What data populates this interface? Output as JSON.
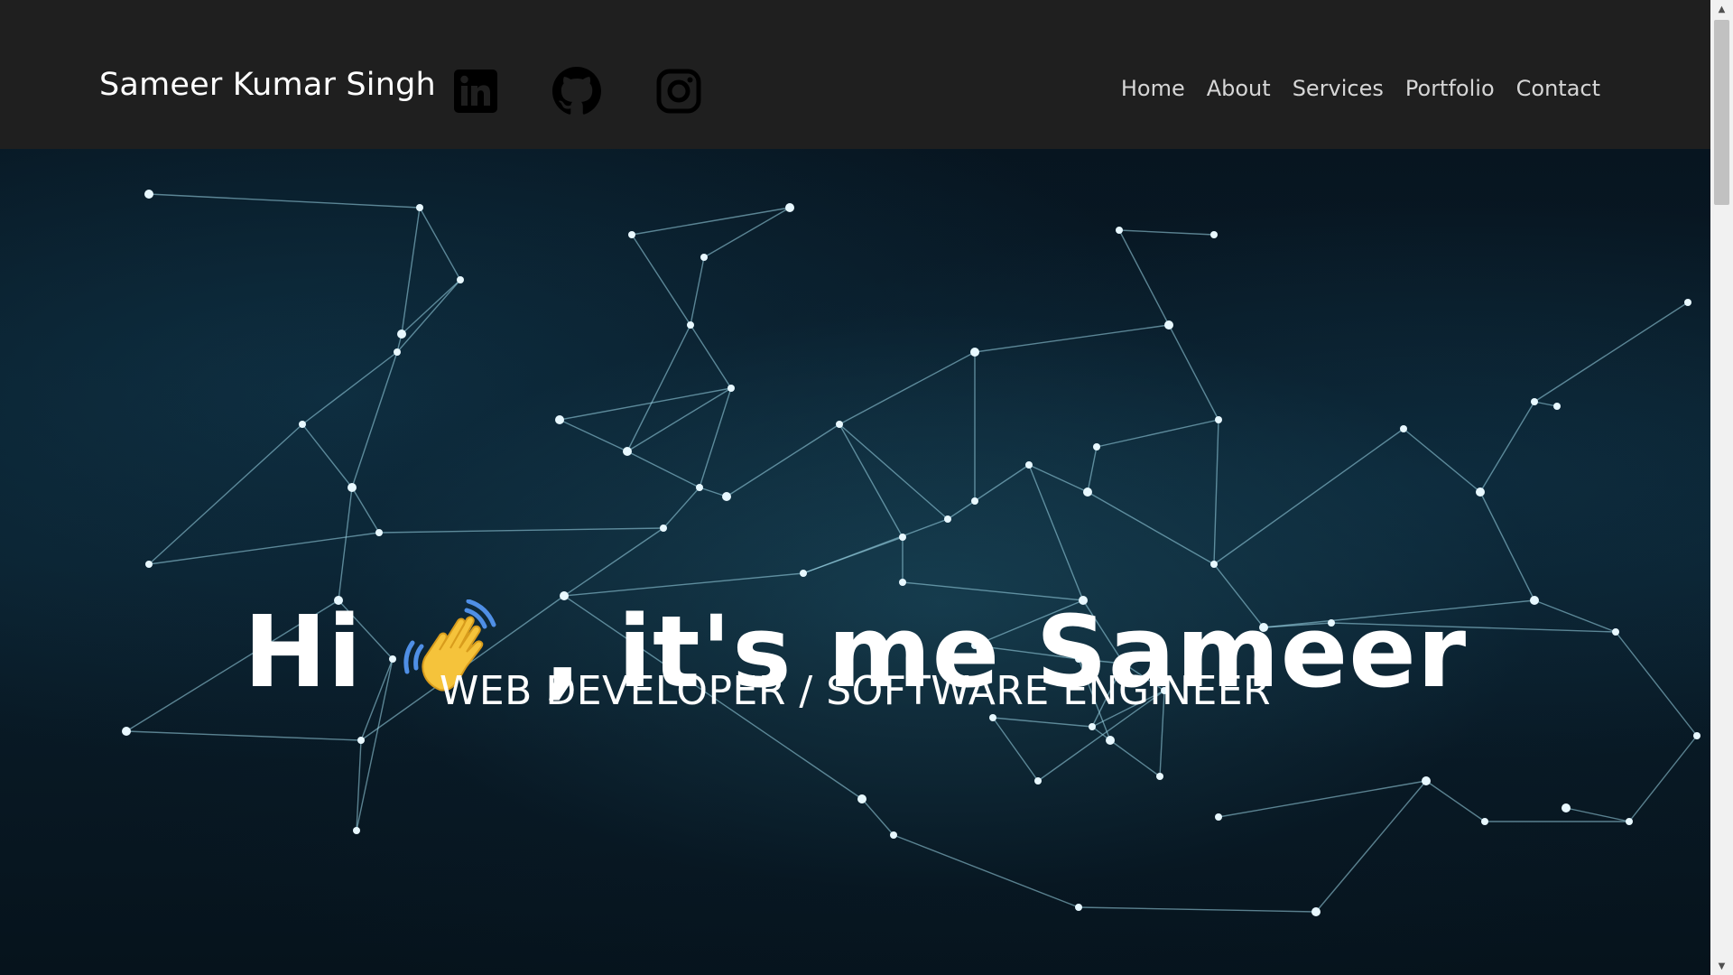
{
  "header": {
    "brand": "Sameer Kumar Singh",
    "social": [
      {
        "name": "linkedin-icon"
      },
      {
        "name": "github-icon"
      },
      {
        "name": "instagram-icon"
      }
    ],
    "nav": [
      "Home",
      "About",
      "Services",
      "Portfolio",
      "Contact"
    ]
  },
  "hero": {
    "title_pre": "Hi",
    "title_post": ", it's me Sameer",
    "emoji": "waving-hand-emoji",
    "subtitle": "WEB DEVELOPER / SOFTWARE ENGINEER"
  },
  "colors": {
    "header_bg": "#1f1f1f",
    "nav_text": "#d6d6d6",
    "hero_bg": "#071520",
    "network_line": "#9ed8ea",
    "wave_hand": "#f5c33b",
    "wave_lines": "#4f8fe6"
  }
}
